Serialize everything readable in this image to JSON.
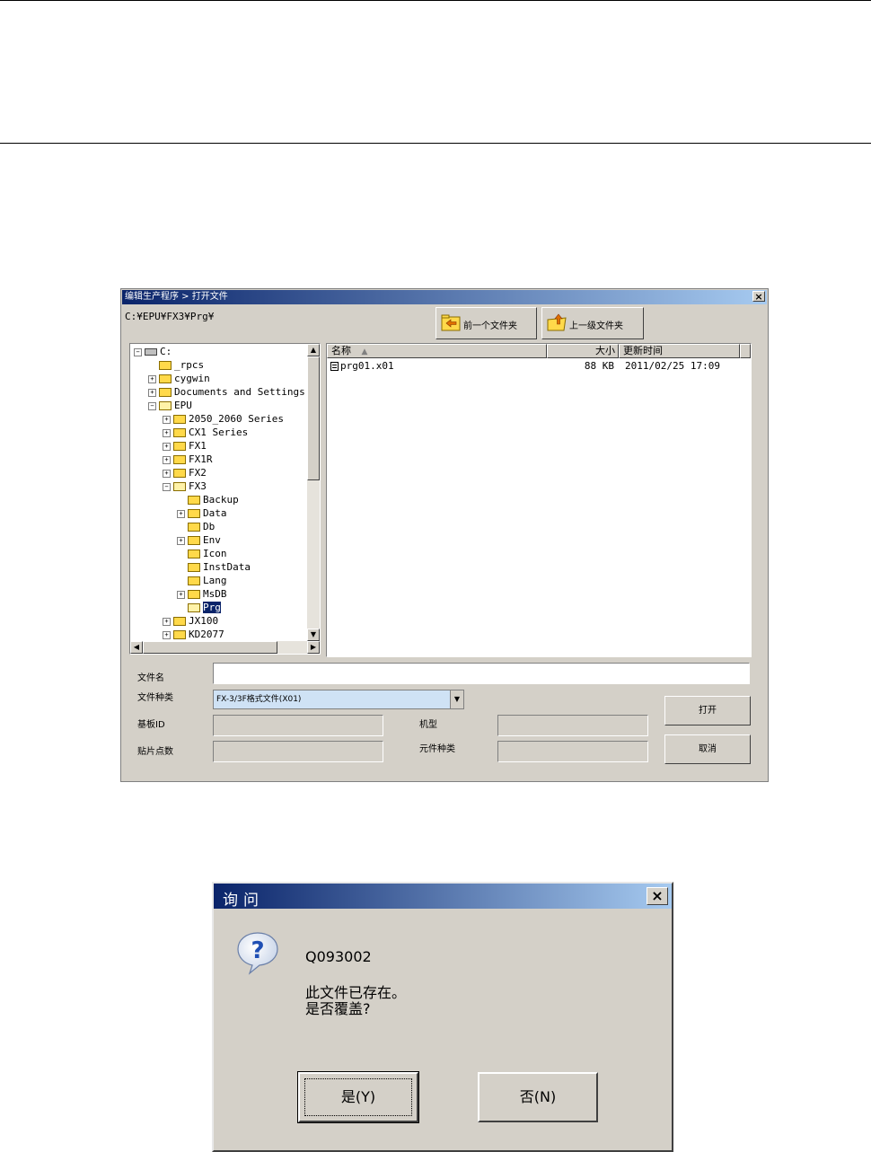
{
  "open_dialog": {
    "title": "编辑生产程序 > 打开文件",
    "close_label": "×",
    "path": "C:¥EPU¥FX3¥Prg¥",
    "back_button": "前一个文件夹",
    "up_button": "上一级文件夹",
    "tree": [
      {
        "label": "C:",
        "toggle": "⊟",
        "depth": 0,
        "root": true
      },
      {
        "label": "_rpcs",
        "toggle": "",
        "depth": 1
      },
      {
        "label": "cygwin",
        "toggle": "+",
        "depth": 1
      },
      {
        "label": "Documents and Settings",
        "toggle": "+",
        "depth": 1
      },
      {
        "label": "EPU",
        "toggle": "−",
        "depth": 1,
        "open": true
      },
      {
        "label": "2050_2060 Series",
        "toggle": "+",
        "depth": 2
      },
      {
        "label": "CX1 Series",
        "toggle": "+",
        "depth": 2
      },
      {
        "label": "FX1",
        "toggle": "+",
        "depth": 2
      },
      {
        "label": "FX1R",
        "toggle": "+",
        "depth": 2
      },
      {
        "label": "FX2",
        "toggle": "+",
        "depth": 2
      },
      {
        "label": "FX3",
        "toggle": "−",
        "depth": 2,
        "open": true
      },
      {
        "label": "Backup",
        "toggle": "",
        "depth": 3
      },
      {
        "label": "Data",
        "toggle": "+",
        "depth": 3
      },
      {
        "label": "Db",
        "toggle": "",
        "depth": 3
      },
      {
        "label": "Env",
        "toggle": "+",
        "depth": 3
      },
      {
        "label": "Icon",
        "toggle": "",
        "depth": 3
      },
      {
        "label": "InstData",
        "toggle": "",
        "depth": 3
      },
      {
        "label": "Lang",
        "toggle": "",
        "depth": 3
      },
      {
        "label": "MsDB",
        "toggle": "+",
        "depth": 3
      },
      {
        "label": "Prg",
        "toggle": "",
        "depth": 3,
        "selected": true,
        "open": true
      },
      {
        "label": "JX100",
        "toggle": "+",
        "depth": 2
      },
      {
        "label": "KD2077",
        "toggle": "+",
        "depth": 2
      }
    ],
    "columns": {
      "name": "名称",
      "sort_glyph": "▲",
      "size": "大小",
      "modified": "更新时间"
    },
    "files": [
      {
        "name": "prg01.x01",
        "size": "88 KB",
        "modified": "2011/02/25 17:09"
      }
    ],
    "filename_label": "文件名",
    "filename_value": "",
    "filetype_label": "文件种类",
    "filetype_value": "FX-3/3F格式文件(X01)",
    "board_id_label": "基板ID",
    "model_label": "机型",
    "mount_count_label": "贴片点数",
    "component_type_label": "元件种类",
    "open_button": "打开",
    "cancel_button": "取消"
  },
  "confirm_dialog": {
    "title": "询问",
    "close_label": "×",
    "code": "Q093002",
    "line1": "此文件已存在。",
    "line2": "是否覆盖?",
    "yes_button": "是(Y)",
    "no_button": "否(N)"
  }
}
